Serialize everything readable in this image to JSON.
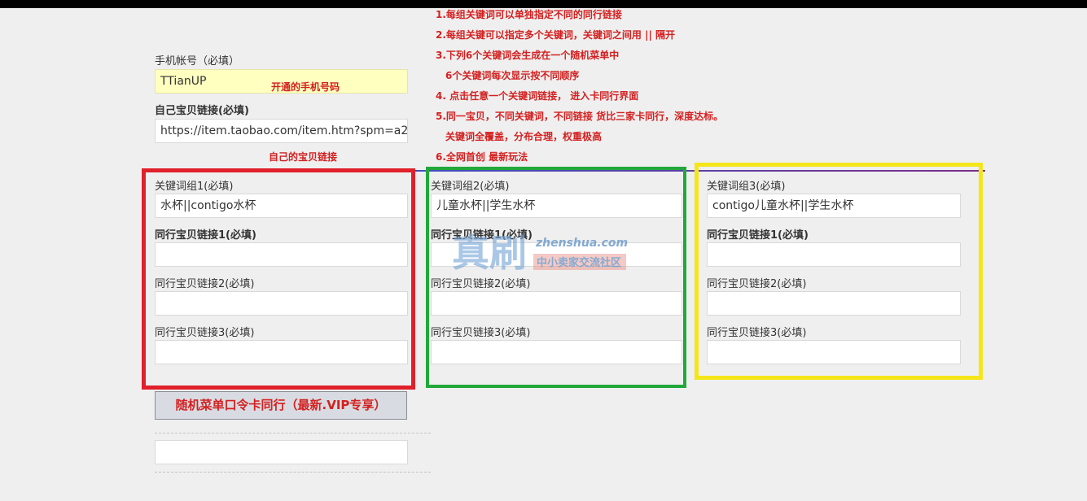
{
  "instructions": [
    "1.每组关键词可以单独指定不同的同行链接",
    "2.每组关键可以指定多个关键词，关键词之间用 || 隔开",
    "3.下列6个关键词会生成在一个随机菜单中",
    "6个关键词每次显示按不同顺序",
    "4. 点击任意一个关键词链接， 进入卡同行界面",
    "5.同一宝贝，不同关键词，不同链接 货比三家卡同行，深度达标。",
    "关键词全覆盖，分布合理，权重极高",
    "6.全网首创 最新玩法"
  ],
  "phone": {
    "label": "手机帐号（必填）",
    "value": "TTianUP",
    "note": "开通的手机号码"
  },
  "own_link": {
    "label": "自己宝贝链接(必填)",
    "value": "https://item.taobao.com/item.htm?spm=a2",
    "note": "自己的宝贝链接"
  },
  "groups": [
    {
      "keyword_label": "关键词组1(必填)",
      "keyword_value": "水杯||contigo水杯",
      "link1_label": "同行宝贝链接1(必填)",
      "link2_label": "同行宝贝链接2(必填)",
      "link3_label": "同行宝贝链接3(必填)"
    },
    {
      "keyword_label": "关键词组2(必填)",
      "keyword_value": "儿童水杯||学生水杯",
      "link1_label": "同行宝贝链接1(必填)",
      "link2_label": "同行宝贝链接2(必填)",
      "link3_label": "同行宝贝链接3(必填)"
    },
    {
      "keyword_label": "关键词组3(必填)",
      "keyword_value": "contigo儿童水杯||学生水杯",
      "link1_label": "同行宝贝链接1(必填)",
      "link2_label": "同行宝贝链接2(必填)",
      "link3_label": "同行宝贝链接3(必填)"
    }
  ],
  "submit_label": "随机菜单口令卡同行（最新.VIP专享）",
  "result_value": "",
  "watermark": {
    "glyphs": "真刷",
    "domain": "zhenshua.com",
    "tagline": "中小卖家交流社区"
  },
  "colors": {
    "instruction_red": "#d42020",
    "box_red": "#e0202a",
    "box_green": "#22a83a",
    "box_yellow": "#f5e61a",
    "phone_bg": "#ffffc0"
  }
}
